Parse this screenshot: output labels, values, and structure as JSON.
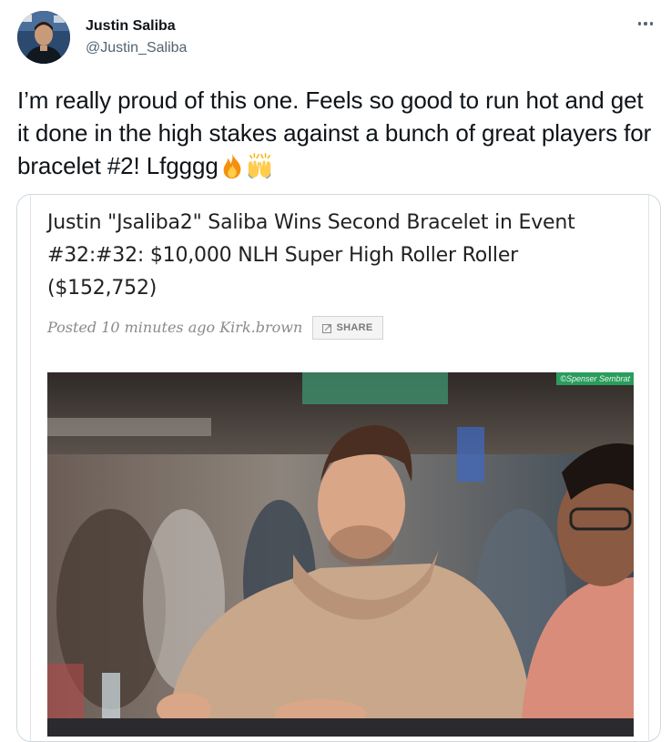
{
  "author": {
    "name": "Justin Saliba",
    "handle": "@Justin_Saliba"
  },
  "tweet": {
    "text": "I’m really proud of this one. Feels so good to run hot and get it done in the high stakes against a bunch of great players for bracelet #2! Lfgggg",
    "emojis": [
      "fire-icon",
      "raising-hands-icon"
    ]
  },
  "card": {
    "title": "Justin \"Jsaliba2\" Saliba Wins Second Bracelet in Event #32:#32: $10,000 NLH Super High Roller Roller ($152,752)",
    "meta": "Posted 10 minutes ago Kirk.brown",
    "share_label": "SHARE",
    "photo_credit": "©Spenser Sembrat"
  },
  "colors": {
    "text": "#0f1419",
    "secondary": "#536471",
    "card_border": "#cfd9de",
    "credit_bg": "#2a9d5c"
  }
}
